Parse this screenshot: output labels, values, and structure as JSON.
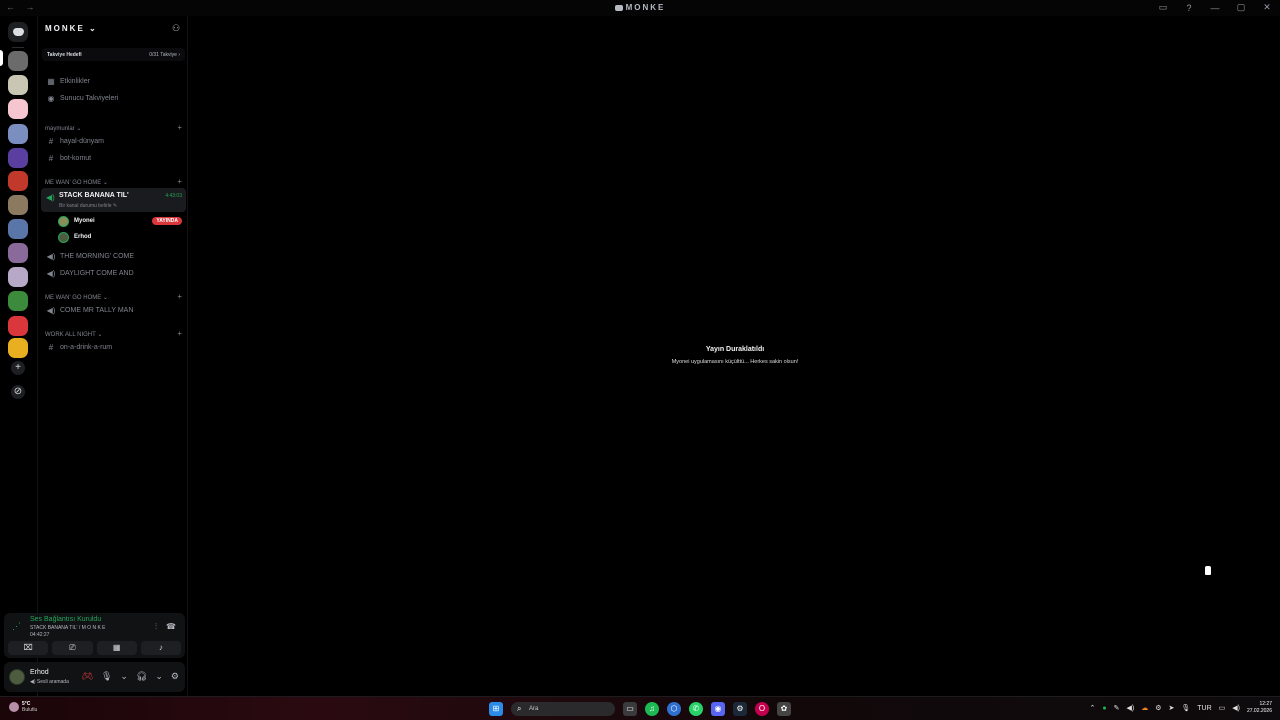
{
  "window": {
    "title": "MONKE",
    "nav": "← →",
    "controls": [
      "▭",
      "?",
      "—",
      "▢",
      "✕"
    ]
  },
  "guilds": {
    "colors": [
      "#6b6b6b",
      "#c9c7b3",
      "#f5c6cf",
      "#7a8fbf",
      "#5b3fa0",
      "#c0392b",
      "#8c7a60",
      "#5a76a8",
      "#8a6a9a",
      "#b7a8c8",
      "#3c8a3c",
      "#da373c",
      "#e8b020"
    ],
    "add_label": "+",
    "explore_label": "⊘"
  },
  "server": {
    "name": "MONKE",
    "boost_goal_label": "Takviye Hedefi",
    "boost_count": "0/31 Takviye",
    "shortcuts": [
      {
        "icon": "▦",
        "label": "Etkinlikler"
      },
      {
        "icon": "◉",
        "label": "Sunucu Takviyeleri"
      }
    ],
    "categories": [
      {
        "name": "maymunlar",
        "channels": [
          {
            "type": "text",
            "name": "hayal-dünyam"
          },
          {
            "type": "text",
            "name": "bot-komut"
          }
        ]
      },
      {
        "name": "ME WAN' GO HOME"
      },
      {
        "name": "ME WAN' GO HOME"
      },
      {
        "name": "WORK ALL NIGHT"
      }
    ],
    "active_voice": {
      "name": "STACK BANANA TIL'",
      "status": "Bir kanal durumu belirle",
      "timer": "4:43:03",
      "members": [
        {
          "name": "Myonei",
          "color": "#8a8f5a",
          "badge": "YAYINDA"
        },
        {
          "name": "Erhod",
          "color": "#4d5c3f"
        }
      ]
    },
    "voice_channels_1": [
      "THE MORNING' COME",
      "DAYLIGHT COME AND"
    ],
    "voice_channels_2": [
      "COME MR TALLY MAN"
    ],
    "text_channels_3": [
      "on-a-drink-a-rum"
    ]
  },
  "voice_connection": {
    "status": "Ses Bağlantısı Kuruldu",
    "channel": "STACK BANANA TIL' / M O N K E",
    "time": "04:42:27",
    "buttons": [
      "⌧",
      "⎚",
      "▦",
      "♪"
    ]
  },
  "user": {
    "name": "Erhod",
    "status": "Sesli aramada"
  },
  "stream": {
    "title": "Yayın Duraklatıldı",
    "subtitle": "Myonei uygulamasını küçülttü... Herkes sakin olsun!"
  },
  "taskbar": {
    "weather_temp": "5°C",
    "weather_desc": "Bulutlu",
    "search_placeholder": "Ara",
    "lang": "TUR",
    "time": "12:27",
    "date": "27.02.2026"
  }
}
